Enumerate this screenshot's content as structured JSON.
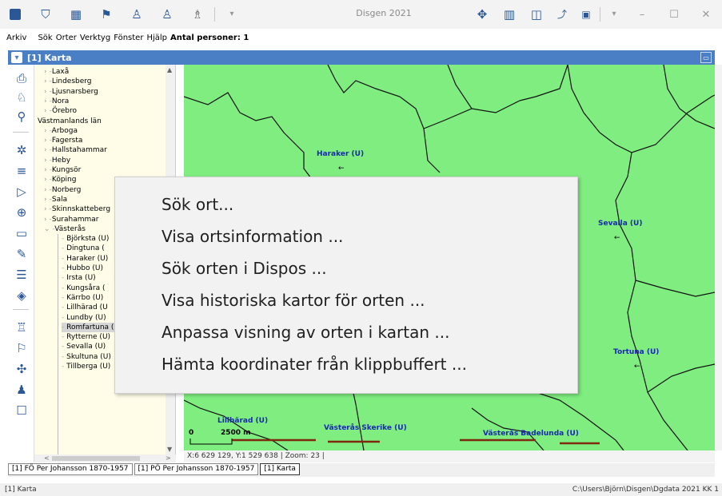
{
  "window": {
    "title": "Disgen 2021"
  },
  "toolbar": {
    "icons": [
      "disgen-logo-icon",
      "filter-icon",
      "calendar-icon",
      "flag-icon",
      "person-down-icon",
      "person-up-icon",
      "figure-icon",
      "dropdown-icon"
    ],
    "right_icons": [
      "move-icon",
      "grid-icon",
      "window-icon",
      "share-icon",
      "tool-icon",
      "dropdown-icon"
    ]
  },
  "menu": {
    "items": [
      "Arkiv",
      "Sök",
      "Orter",
      "Verktyg",
      "Fönster",
      "Hjälp"
    ],
    "persons": "Antal personer: 1"
  },
  "child_window": {
    "title": "[1] Karta"
  },
  "tree": {
    "items": [
      {
        "text": "Laxå",
        "kind": "collapsed",
        "level": 1
      },
      {
        "text": "Lindesberg",
        "kind": "collapsed",
        "level": 1
      },
      {
        "text": "Ljusnarsberg",
        "kind": "collapsed",
        "level": 1
      },
      {
        "text": "Nora",
        "kind": "collapsed",
        "level": 1
      },
      {
        "text": "Örebro",
        "kind": "collapsed",
        "level": 1
      },
      {
        "text": "Västmanlands län",
        "kind": "header",
        "level": 0
      },
      {
        "text": "Arboga",
        "kind": "collapsed",
        "level": 1
      },
      {
        "text": "Fagersta",
        "kind": "collapsed",
        "level": 1
      },
      {
        "text": "Hallstahammar",
        "kind": "collapsed",
        "level": 1
      },
      {
        "text": "Heby",
        "kind": "collapsed",
        "level": 1
      },
      {
        "text": "Kungsör",
        "kind": "collapsed",
        "level": 1
      },
      {
        "text": "Köping",
        "kind": "collapsed",
        "level": 1
      },
      {
        "text": "Norberg",
        "kind": "collapsed",
        "level": 1
      },
      {
        "text": "Sala",
        "kind": "collapsed",
        "level": 1
      },
      {
        "text": "Skinnskatteberg",
        "kind": "collapsed",
        "level": 1
      },
      {
        "text": "Surahammar",
        "kind": "collapsed",
        "level": 1
      },
      {
        "text": "Västerås",
        "kind": "expanded",
        "level": 1
      },
      {
        "text": "Björksta (U)",
        "kind": "leaf",
        "level": 2
      },
      {
        "text": "Dingtuna (",
        "kind": "leaf",
        "level": 2
      },
      {
        "text": "Haraker (U)",
        "kind": "leaf",
        "level": 2
      },
      {
        "text": "Hubbo (U)",
        "kind": "leaf",
        "level": 2
      },
      {
        "text": "Irsta (U)",
        "kind": "leaf",
        "level": 2
      },
      {
        "text": "Kungsåra (",
        "kind": "leaf",
        "level": 2
      },
      {
        "text": "Kärrbo (U)",
        "kind": "leaf",
        "level": 2
      },
      {
        "text": "Lillhärad (U",
        "kind": "leaf",
        "level": 2
      },
      {
        "text": "Lundby (U)",
        "kind": "leaf",
        "level": 2
      },
      {
        "text": "Romfartuna (U)",
        "kind": "leaf-selected",
        "level": 2
      },
      {
        "text": "Rytterne (U)",
        "kind": "leaf",
        "level": 2
      },
      {
        "text": "Sevalla (U)",
        "kind": "leaf",
        "level": 2
      },
      {
        "text": "Skultuna (U)",
        "kind": "leaf",
        "level": 2
      },
      {
        "text": "Tillberga (U)",
        "kind": "leaf",
        "level": 2
      }
    ]
  },
  "map": {
    "places": [
      {
        "name": "Haraker (U)"
      },
      {
        "name": "Sevalla (U)"
      },
      {
        "name": "Tortuna (U)"
      },
      {
        "name": "Lillhärad (U)"
      },
      {
        "name": "Västerås Skerike (U)"
      },
      {
        "name": "Västerås Badelunda (U)"
      }
    ],
    "scale_zero": "0",
    "scale_label": "2500 m",
    "status": "X:6 629 129, Y:1 529 638  |  Zoom: 23  |",
    "background_color": "#7fed7f",
    "label_color": "#1a28b5"
  },
  "context_menu": {
    "items": [
      "Sök ort...",
      "Visa ortsinformation ...",
      "Sök orten i Dispos ...",
      "Visa historiska kartor för orten ...",
      "Anpassa visning av orten i kartan ...",
      "Hämta koordinater från klippbuffert ..."
    ]
  },
  "tabs": [
    "[1] FÖ Per Johansson 1870-1957",
    "[1] PÖ Per Johansson 1870-1957",
    "[1] Karta"
  ],
  "status": {
    "left": "[1] Karta",
    "right": "C:\\Users\\Björn\\Disgen\\Dgdata 2021 KK 1"
  }
}
